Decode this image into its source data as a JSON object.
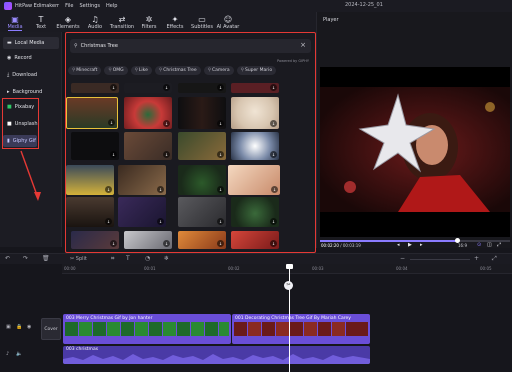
{
  "titlebar": {
    "app": "HitPaw Edimakerr",
    "menus": [
      "File",
      "Settings",
      "Help"
    ],
    "title": "2024-12-25_01"
  },
  "toolbar": [
    {
      "label": "Media",
      "icon": "media-icon",
      "active": true
    },
    {
      "label": "Text",
      "icon": "text-icon"
    },
    {
      "label": "Elements",
      "icon": "elements-icon"
    },
    {
      "label": "Audio",
      "icon": "audio-icon"
    },
    {
      "label": "Transition",
      "icon": "transition-icon"
    },
    {
      "label": "Filters",
      "icon": "filters-icon"
    },
    {
      "label": "Effects",
      "icon": "effects-icon"
    },
    {
      "label": "Subtitles",
      "icon": "subtitles-icon"
    },
    {
      "label": "AI Avatar",
      "icon": "ai-avatar-icon"
    }
  ],
  "sidebar": {
    "items": [
      "Local Media",
      "Record",
      "Download",
      "Background",
      "Pixabay",
      "Unsplash",
      "Giphy Gif"
    ]
  },
  "gif_panel": {
    "search_value": "Christmas Tree",
    "powered_by": "Powered by GIPHY",
    "tags": [
      "Minecraft",
      "OMG",
      "Like",
      "Christmas Tree",
      "Camera",
      "Super Mario"
    ]
  },
  "player": {
    "title": "Player",
    "current_time": "00:02:20",
    "total_time": "00:03:19",
    "aspect_ratio": "16:9",
    "progress": 0.72
  },
  "timeline": {
    "split_label": "Split",
    "ruler": [
      "00:00",
      "00:01",
      "00:02",
      "00:03",
      "00:04",
      "00:05"
    ],
    "cover_label": "Cover",
    "clip1": "003 Merry Christmas Gif by Jon hanter",
    "clip2": "001 Decorating Christmas Tree Gif By Mariah Carey",
    "audio": "003 christmas"
  },
  "colors": {
    "accent": "#8b7cff",
    "highlight": "#e53935",
    "clip": "#6a4ed8",
    "audio": "#4a3aa6"
  }
}
